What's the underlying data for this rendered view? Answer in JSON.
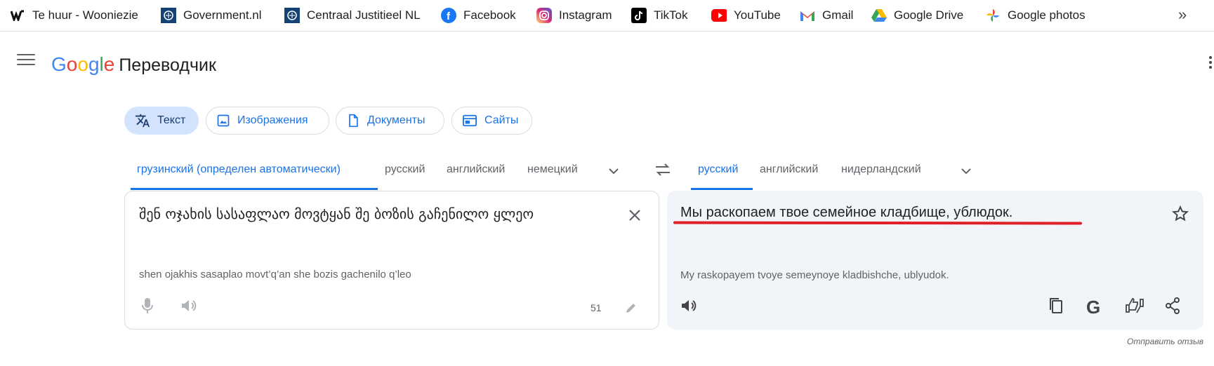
{
  "bookmarks": [
    {
      "label": "Te huur - Wooniezie",
      "icon": "wooniezie-icon"
    },
    {
      "label": "Government.nl",
      "icon": "government-crest-icon"
    },
    {
      "label": "Centraal Justitieel NL",
      "icon": "justice-crest-icon"
    },
    {
      "label": "Facebook",
      "icon": "facebook-icon"
    },
    {
      "label": "Instagram",
      "icon": "instagram-icon"
    },
    {
      "label": "TikTok",
      "icon": "tiktok-icon"
    },
    {
      "label": "YouTube",
      "icon": "youtube-icon"
    },
    {
      "label": "Gmail",
      "icon": "gmail-icon"
    },
    {
      "label": "Google Drive",
      "icon": "google-drive-icon"
    },
    {
      "label": "Google photos",
      "icon": "google-photos-icon"
    }
  ],
  "bookmarks_more": "»",
  "header": {
    "logo_letters": [
      "G",
      "o",
      "o",
      "g",
      "l",
      "e"
    ],
    "product": "Переводчик"
  },
  "modes": [
    {
      "label": "Текст",
      "icon": "translate-icon",
      "active": true
    },
    {
      "label": "Изображения",
      "icon": "image-icon",
      "active": false
    },
    {
      "label": "Документы",
      "icon": "document-icon",
      "active": false
    },
    {
      "label": "Сайты",
      "icon": "website-icon",
      "active": false
    }
  ],
  "source_langs": [
    "грузинский (определен автоматически)",
    "русский",
    "английский",
    "немецкий"
  ],
  "target_langs": [
    "русский",
    "английский",
    "нидерландский"
  ],
  "source": {
    "text": "შენ ოჯახის სასაფლაო მოვტყან შე ბოზის გაჩენილო ყლეო",
    "transliteration": "shen ojakhis sasaplao movt’q’an she bozis gachenilo q’leo",
    "char_count": "51"
  },
  "target": {
    "text": "Мы раскопаем твое семейное кладбище, ублюдок.",
    "transliteration": "My raskopayem tvoye semeynoye kladbishche, ublyudok."
  },
  "feedback": "Отправить отзыв",
  "colors": {
    "accent": "#1a73e8",
    "active_chip": "#d3e3fd",
    "target_bg": "#f1f4f9",
    "annotation": "#e11f26"
  }
}
